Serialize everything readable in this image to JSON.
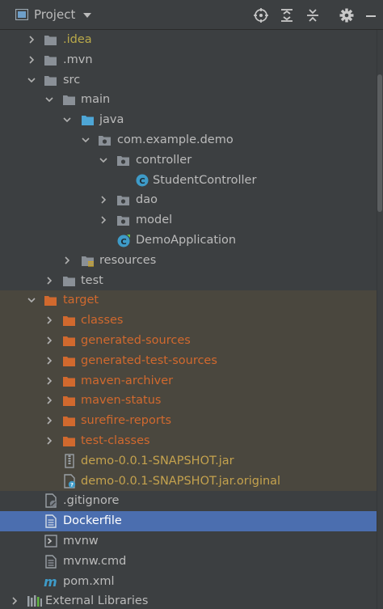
{
  "header": {
    "title": "Project"
  },
  "colors": {
    "background": "#3c3f41",
    "excluded_folder_bg": "#4a473e",
    "selected_row_bg": "#4b6eaf",
    "folder": "#8a9097",
    "source_folder": "#4ea6d6",
    "excluded_folder": "#d1692e",
    "class_icon": "#3e9bc8"
  },
  "tree": {
    "items": [
      {
        "label": ".idea",
        "icon": "folder-icon",
        "expanded": false
      },
      {
        "label": ".mvn",
        "icon": "folder-icon",
        "expanded": false
      },
      {
        "label": "src",
        "icon": "folder-icon",
        "expanded": true
      },
      {
        "label": "main",
        "icon": "folder-icon",
        "expanded": true
      },
      {
        "label": "java",
        "icon": "source-folder-icon",
        "expanded": true
      },
      {
        "label": "com.example.demo",
        "icon": "package-icon",
        "expanded": true
      },
      {
        "label": "controller",
        "icon": "package-icon",
        "expanded": true
      },
      {
        "label": "StudentController",
        "icon": "class-icon"
      },
      {
        "label": "dao",
        "icon": "package-icon",
        "expanded": false
      },
      {
        "label": "model",
        "icon": "package-icon",
        "expanded": false
      },
      {
        "label": "DemoApplication",
        "icon": "spring-class-icon"
      },
      {
        "label": "resources",
        "icon": "resources-folder-icon",
        "expanded": false
      },
      {
        "label": "test",
        "icon": "folder-icon",
        "expanded": false
      },
      {
        "label": "target",
        "icon": "excluded-folder-icon",
        "expanded": true
      },
      {
        "label": "classes",
        "icon": "excluded-folder-icon",
        "expanded": false
      },
      {
        "label": "generated-sources",
        "icon": "excluded-folder-icon",
        "expanded": false
      },
      {
        "label": "generated-test-sources",
        "icon": "excluded-folder-icon",
        "expanded": false
      },
      {
        "label": "maven-archiver",
        "icon": "excluded-folder-icon",
        "expanded": false
      },
      {
        "label": "maven-status",
        "icon": "excluded-folder-icon",
        "expanded": false
      },
      {
        "label": "surefire-reports",
        "icon": "excluded-folder-icon",
        "expanded": false
      },
      {
        "label": "test-classes",
        "icon": "excluded-folder-icon",
        "expanded": false
      },
      {
        "label": "demo-0.0.1-SNAPSHOT.jar",
        "icon": "jar-icon"
      },
      {
        "label": "demo-0.0.1-SNAPSHOT.jar.original",
        "icon": "unknown-file-icon"
      },
      {
        "label": ".gitignore",
        "icon": "gitignore-icon"
      },
      {
        "label": "Dockerfile",
        "icon": "text-file-icon",
        "selected": true
      },
      {
        "label": "mvnw",
        "icon": "shell-script-icon"
      },
      {
        "label": "mvnw.cmd",
        "icon": "text-file-icon"
      },
      {
        "label": "pom.xml",
        "icon": "maven-icon"
      },
      {
        "label": "External Libraries",
        "icon": "libraries-icon",
        "expanded": false
      }
    ]
  }
}
